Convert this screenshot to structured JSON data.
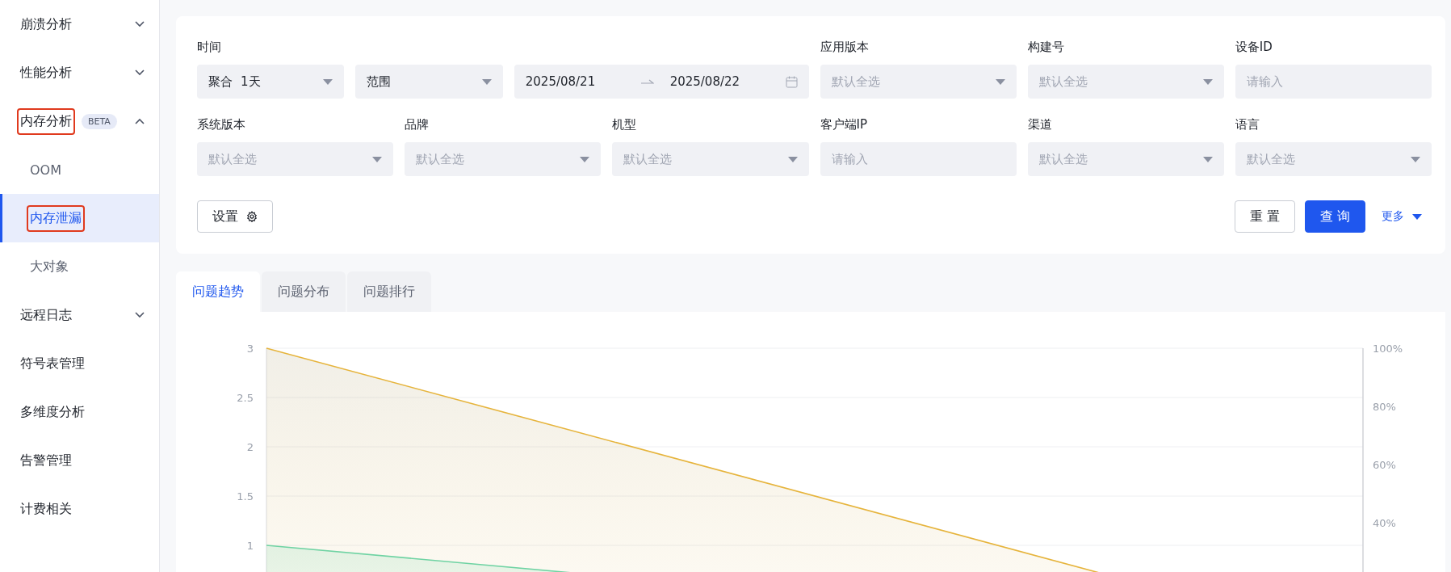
{
  "sidebar": {
    "items": [
      {
        "label": "崩溃分析",
        "expanded": false,
        "selected": false
      },
      {
        "label": "性能分析",
        "expanded": false,
        "selected": false
      },
      {
        "label": "内存分析",
        "badge": "BETA",
        "expanded": true,
        "selected": false,
        "annotated": true,
        "children": [
          {
            "label": "OOM",
            "selected": false,
            "annotated": false
          },
          {
            "label": "内存泄漏",
            "selected": true,
            "annotated": true
          },
          {
            "label": "大对象",
            "selected": false,
            "annotated": false
          }
        ]
      },
      {
        "label": "远程日志",
        "expanded": false,
        "selected": false
      },
      {
        "label": "符号表管理",
        "selected": false
      },
      {
        "label": "多维度分析",
        "selected": false
      },
      {
        "label": "告警管理",
        "selected": false
      },
      {
        "label": "计费相关",
        "selected": false
      }
    ]
  },
  "filters": {
    "time": {
      "label": "时间",
      "aggregate": {
        "prefix": "聚合",
        "value": "1天"
      },
      "range": {
        "value": "范围"
      },
      "date_range": {
        "start": "2025/08/21",
        "end": "2025/08/22"
      }
    },
    "fields": [
      {
        "label": "应用版本",
        "kind": "select",
        "placeholder": "默认全选"
      },
      {
        "label": "构建号",
        "kind": "select",
        "placeholder": "默认全选"
      },
      {
        "label": "设备ID",
        "kind": "input",
        "placeholder": "请输入"
      },
      {
        "label": "系统版本",
        "kind": "select",
        "placeholder": "默认全选"
      },
      {
        "label": "品牌",
        "kind": "select",
        "placeholder": "默认全选"
      },
      {
        "label": "机型",
        "kind": "select",
        "placeholder": "默认全选"
      },
      {
        "label": "客户端IP",
        "kind": "input",
        "placeholder": "请输入"
      },
      {
        "label": "渠道",
        "kind": "select",
        "placeholder": "默认全选"
      },
      {
        "label": "语言",
        "kind": "select",
        "placeholder": "默认全选"
      }
    ],
    "settings_button": "设置",
    "reset_button": "重 置",
    "query_button": "查 询",
    "more_link": "更多"
  },
  "tabs": [
    {
      "label": "问题趋势",
      "selected": true
    },
    {
      "label": "问题分布",
      "selected": false
    },
    {
      "label": "问题排行",
      "selected": false
    }
  ],
  "chart": {
    "left_axis_ticks": [
      "3",
      "2.5",
      "2",
      "1.5",
      "1"
    ],
    "right_axis_ticks": [
      "100%",
      "80%",
      "60%",
      "40%"
    ]
  }
}
